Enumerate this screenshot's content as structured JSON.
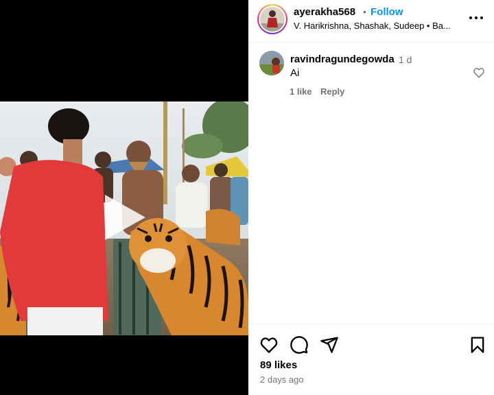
{
  "post": {
    "author": {
      "username": "ayerakha568",
      "separator": "•",
      "follow_label": "Follow",
      "subtitle": "V. Harikrishna, Shashak, Sudeep • Ba..."
    },
    "menu_icon": "more-horizontal-icon",
    "media": {
      "type": "video",
      "play_icon": "play-icon"
    },
    "comments": [
      {
        "username": "ravindragundegowda",
        "time": "1 d",
        "text": "Ai",
        "like_count": "1 like",
        "reply_label": "Reply",
        "like_icon": "heart-outline-icon"
      }
    ],
    "actions": {
      "icons": [
        "heart-outline-icon",
        "comment-icon",
        "share-icon",
        "bookmark-icon"
      ]
    },
    "likes": "89 likes",
    "posted": "2 days ago"
  },
  "colors": {
    "follow_blue": "#0095f6",
    "muted_text": "#737373",
    "divider": "#efefef"
  }
}
